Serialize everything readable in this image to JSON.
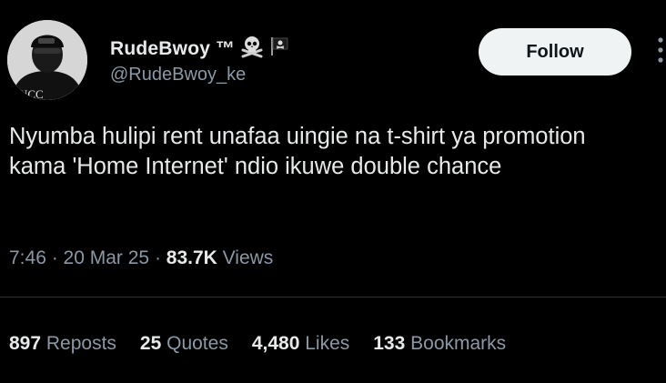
{
  "author": {
    "display_name": "RudeBwoy ™",
    "handle": "@RudeBwoy_ke",
    "avatar_text": "UCC",
    "badges": [
      "skull-crossbones-icon",
      "pirate-flag-icon"
    ]
  },
  "follow_label": "Follow",
  "tweet": {
    "text": "Nyumba hulipi rent unafaa uingie na t-shirt ya promotion kama 'Home Internet' ndio ikuwe double chance"
  },
  "meta": {
    "time": "7:46",
    "sep1": " · ",
    "date": "20 Mar 25",
    "sep2": " · ",
    "views_count": "83.7K",
    "views_label": " Views"
  },
  "stats": [
    {
      "count": "897",
      "label": " Reposts"
    },
    {
      "count": "25",
      "label": " Quotes"
    },
    {
      "count": "4,480",
      "label": " Likes"
    },
    {
      "count": "133",
      "label": " Bookmarks"
    }
  ],
  "colors": {
    "background": "#000000",
    "text": "#e7e9ea",
    "secondary": "#8b98a5",
    "divider": "#2f3336",
    "button_bg": "#eff3f4"
  }
}
